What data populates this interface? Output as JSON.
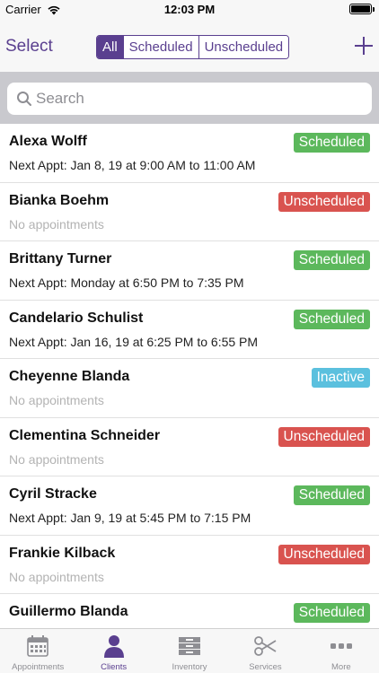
{
  "status_bar": {
    "carrier": "Carrier",
    "time": "12:03 PM"
  },
  "nav": {
    "select_label": "Select",
    "segments": [
      "All",
      "Scheduled",
      "Unscheduled"
    ],
    "active_segment": "All"
  },
  "search": {
    "placeholder": "Search"
  },
  "colors": {
    "accent": "#5a3f8f",
    "scheduled": "#5cb85c",
    "unscheduled": "#d9534f",
    "inactive": "#5bc0de"
  },
  "clients": [
    {
      "name": "Alexa Wolff",
      "appointment": "Next Appt: Jan 8, 19 at 9:00 AM to 11:00 AM",
      "status": "Scheduled"
    },
    {
      "name": "Bianka Boehm",
      "appointment": "No appointments",
      "status": "Unscheduled"
    },
    {
      "name": "Brittany Turner",
      "appointment": "Next Appt: Monday at 6:50 PM to 7:35 PM",
      "status": "Scheduled"
    },
    {
      "name": "Candelario Schulist",
      "appointment": "Next Appt: Jan 16, 19 at 6:25 PM to 6:55 PM",
      "status": "Scheduled"
    },
    {
      "name": "Cheyenne Blanda",
      "appointment": "No appointments",
      "status": "Inactive"
    },
    {
      "name": "Clementina Schneider",
      "appointment": "No appointments",
      "status": "Unscheduled"
    },
    {
      "name": "Cyril Stracke",
      "appointment": "Next Appt: Jan 9, 19 at 5:45 PM to 7:15 PM",
      "status": "Scheduled"
    },
    {
      "name": "Frankie Kilback",
      "appointment": "No appointments",
      "status": "Unscheduled"
    },
    {
      "name": "Guillermo Blanda",
      "appointment": "",
      "status": "Scheduled"
    }
  ],
  "tabs": [
    {
      "label": "Appointments",
      "icon": "calendar-icon"
    },
    {
      "label": "Clients",
      "icon": "person-icon",
      "active": true
    },
    {
      "label": "Inventory",
      "icon": "inventory-icon"
    },
    {
      "label": "Services",
      "icon": "scissors-icon"
    },
    {
      "label": "More",
      "icon": "more-icon"
    }
  ]
}
